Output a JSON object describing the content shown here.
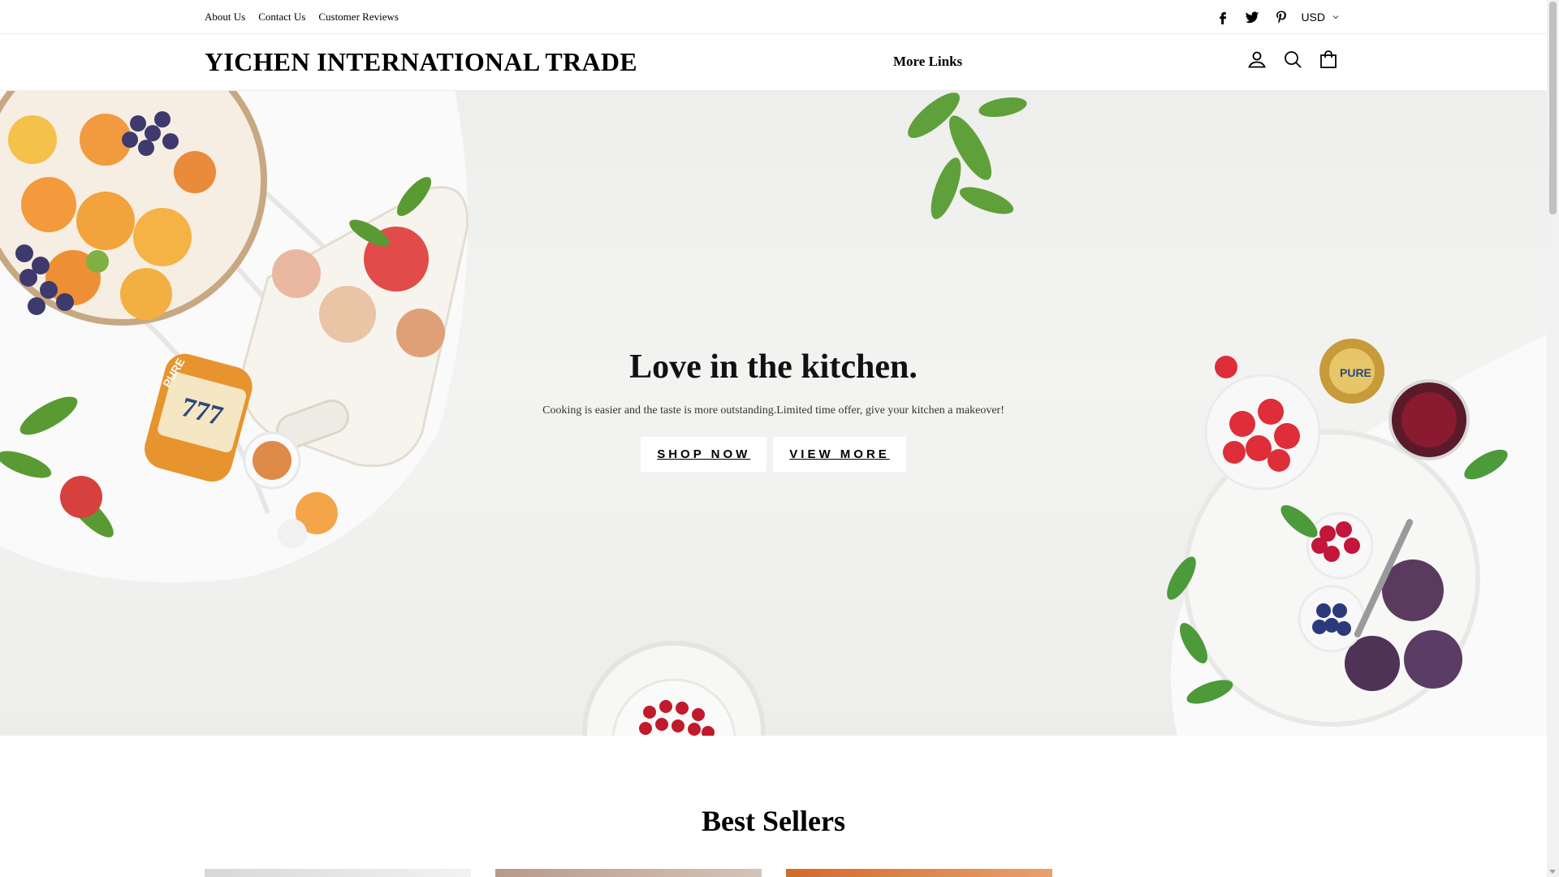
{
  "utility_bar": {
    "links": [
      "About Us",
      "Contact Us",
      "Customer Reviews"
    ],
    "social": [
      "facebook-icon",
      "twitter-icon",
      "pinterest-icon"
    ],
    "currency": "USD"
  },
  "header": {
    "logo": "YICHEN INTERNATIONAL TRADE",
    "nav": [
      "More Links"
    ],
    "icons": [
      "account-icon",
      "search-icon",
      "cart-icon"
    ]
  },
  "hero": {
    "title": "Love in the kitchen.",
    "subtitle": "Cooking is easier and the taste is more outstanding.Limited time offer, give your kitchen a makeover!",
    "buttons": [
      "SHOP NOW",
      "VIEW MORE"
    ],
    "jar_labels": [
      "PURE",
      "777"
    ]
  },
  "best_sellers": {
    "title": "Best Sellers"
  },
  "colors": {
    "text": "#000000",
    "hero_bg": "#efefed",
    "button_bg": "#ffffff"
  }
}
